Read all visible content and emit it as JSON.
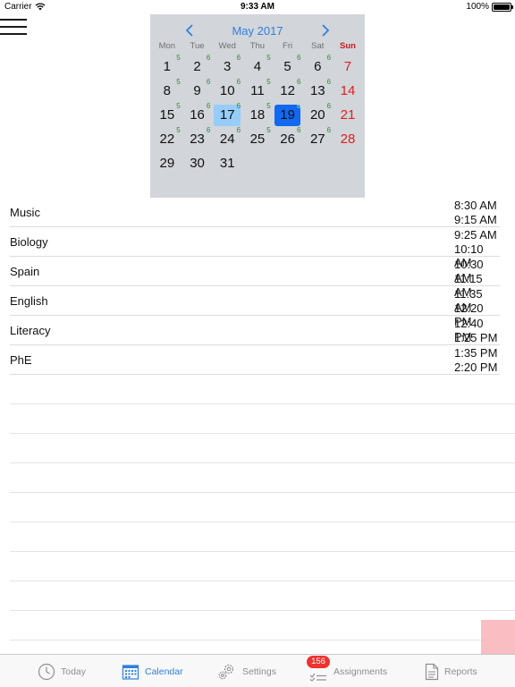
{
  "status_bar": {
    "carrier": "Carrier",
    "time": "9:33 AM",
    "battery": "100%"
  },
  "calendar": {
    "title": "May 2017",
    "weekdays": [
      "Mon",
      "Tue",
      "Wed",
      "Thu",
      "Fri",
      "Sat",
      "Sun"
    ],
    "weeks": [
      [
        {
          "d": "1",
          "c": "5"
        },
        {
          "d": "2",
          "c": "6"
        },
        {
          "d": "3",
          "c": "6"
        },
        {
          "d": "4",
          "c": "5"
        },
        {
          "d": "5",
          "c": "6"
        },
        {
          "d": "6",
          "c": "6"
        },
        {
          "d": "7",
          "c": ""
        }
      ],
      [
        {
          "d": "8",
          "c": "5"
        },
        {
          "d": "9",
          "c": "6"
        },
        {
          "d": "10",
          "c": "6"
        },
        {
          "d": "11",
          "c": "5"
        },
        {
          "d": "12",
          "c": "6"
        },
        {
          "d": "13",
          "c": "6"
        },
        {
          "d": "14",
          "c": ""
        }
      ],
      [
        {
          "d": "15",
          "c": "5"
        },
        {
          "d": "16",
          "c": "6"
        },
        {
          "d": "17",
          "c": "6",
          "today": true
        },
        {
          "d": "18",
          "c": "5"
        },
        {
          "d": "19",
          "c": "6",
          "selected": true
        },
        {
          "d": "20",
          "c": "6"
        },
        {
          "d": "21",
          "c": ""
        }
      ],
      [
        {
          "d": "22",
          "c": "5"
        },
        {
          "d": "23",
          "c": "6"
        },
        {
          "d": "24",
          "c": "6"
        },
        {
          "d": "25",
          "c": "5"
        },
        {
          "d": "26",
          "c": "6"
        },
        {
          "d": "27",
          "c": "6"
        },
        {
          "d": "28",
          "c": ""
        }
      ],
      [
        {
          "d": "29",
          "c": ""
        },
        {
          "d": "30",
          "c": ""
        },
        {
          "d": "31",
          "c": ""
        }
      ]
    ]
  },
  "schedule": [
    {
      "subject": "Music",
      "start": "8:30 AM",
      "end": "9:15 AM"
    },
    {
      "subject": "Biology",
      "start": "9:25 AM",
      "end": "10:10 AM"
    },
    {
      "subject": "Spain",
      "start": "10:30 AM",
      "end": "11:15 AM"
    },
    {
      "subject": "English",
      "start": "11:35 AM",
      "end": "12:20 PM"
    },
    {
      "subject": "Literacy",
      "start": "12:40 PM",
      "end": "1:25 PM"
    },
    {
      "subject": "PhE",
      "start": "1:35 PM",
      "end": "2:20 PM"
    }
  ],
  "tab_bar": {
    "today": "Today",
    "calendar": "Calendar",
    "settings": "Settings",
    "assignments": "Assignments",
    "assignments_badge": "156",
    "reports": "Reports",
    "active_tab": "calendar"
  },
  "colors": {
    "accent": "#2f7fe0",
    "calendar_bg": "#d2d5da",
    "today_highlight": "#96cdfa",
    "selected_highlight": "#1169f0",
    "sunday": "#e0201c",
    "event_count": "#2e8b2e",
    "badge": "#f0322f"
  }
}
